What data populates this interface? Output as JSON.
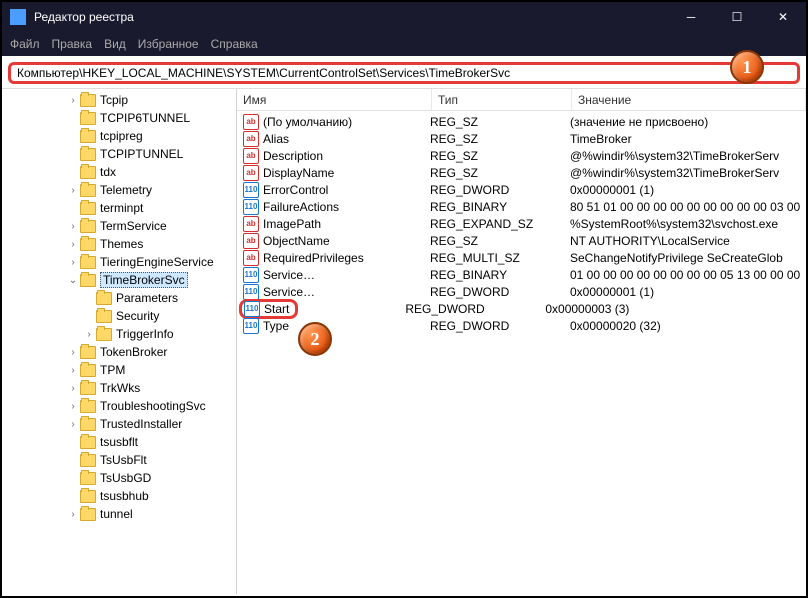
{
  "window": {
    "title": "Редактор реестра"
  },
  "menu": {
    "file": "Файл",
    "edit": "Правка",
    "view": "Вид",
    "fav": "Избранное",
    "help": "Справка"
  },
  "address": "Компьютер\\HKEY_LOCAL_MACHINE\\SYSTEM\\CurrentControlSet\\Services\\TimeBrokerSvc",
  "badges": {
    "b1": "1",
    "b2": "2"
  },
  "tree": [
    {
      "d": 4,
      "e": ">",
      "l": "Tcpip"
    },
    {
      "d": 4,
      "e": "",
      "l": "TCPIP6TUNNEL"
    },
    {
      "d": 4,
      "e": "",
      "l": "tcpipreg"
    },
    {
      "d": 4,
      "e": "",
      "l": "TCPIPTUNNEL"
    },
    {
      "d": 4,
      "e": "",
      "l": "tdx"
    },
    {
      "d": 4,
      "e": ">",
      "l": "Telemetry"
    },
    {
      "d": 4,
      "e": "",
      "l": "terminpt"
    },
    {
      "d": 4,
      "e": ">",
      "l": "TermService"
    },
    {
      "d": 4,
      "e": ">",
      "l": "Themes"
    },
    {
      "d": 4,
      "e": ">",
      "l": "TieringEngineService"
    },
    {
      "d": 4,
      "e": "v",
      "l": "TimeBrokerSvc",
      "sel": true
    },
    {
      "d": 5,
      "e": "",
      "l": "Parameters"
    },
    {
      "d": 5,
      "e": "",
      "l": "Security"
    },
    {
      "d": 5,
      "e": ">",
      "l": "TriggerInfo"
    },
    {
      "d": 4,
      "e": ">",
      "l": "TokenBroker"
    },
    {
      "d": 4,
      "e": ">",
      "l": "TPM"
    },
    {
      "d": 4,
      "e": ">",
      "l": "TrkWks"
    },
    {
      "d": 4,
      "e": ">",
      "l": "TroubleshootingSvc"
    },
    {
      "d": 4,
      "e": ">",
      "l": "TrustedInstaller"
    },
    {
      "d": 4,
      "e": "",
      "l": "tsusbflt"
    },
    {
      "d": 4,
      "e": "",
      "l": "TsUsbFlt"
    },
    {
      "d": 4,
      "e": "",
      "l": "TsUsbGD"
    },
    {
      "d": 4,
      "e": "",
      "l": "tsusbhub"
    },
    {
      "d": 4,
      "e": ">",
      "l": "tunnel"
    }
  ],
  "columns": {
    "name": "Имя",
    "type": "Тип",
    "value": "Значение"
  },
  "values": [
    {
      "ic": "str",
      "name": "(По умолчанию)",
      "type": "REG_SZ",
      "val": "(значение не присвоено)"
    },
    {
      "ic": "str",
      "name": "Alias",
      "type": "REG_SZ",
      "val": "TimeBroker"
    },
    {
      "ic": "str",
      "name": "Description",
      "type": "REG_SZ",
      "val": "@%windir%\\system32\\TimeBrokerServ"
    },
    {
      "ic": "str",
      "name": "DisplayName",
      "type": "REG_SZ",
      "val": "@%windir%\\system32\\TimeBrokerServ"
    },
    {
      "ic": "bin",
      "name": "ErrorControl",
      "type": "REG_DWORD",
      "val": "0x00000001 (1)"
    },
    {
      "ic": "bin",
      "name": "FailureActions",
      "type": "REG_BINARY",
      "val": "80 51 01 00 00 00 00 00 00 00 00 00 03 00"
    },
    {
      "ic": "str",
      "name": "ImagePath",
      "type": "REG_EXPAND_SZ",
      "val": "%SystemRoot%\\system32\\svchost.exe"
    },
    {
      "ic": "str",
      "name": "ObjectName",
      "type": "REG_SZ",
      "val": "NT AUTHORITY\\LocalService"
    },
    {
      "ic": "str",
      "name": "RequiredPrivileges",
      "type": "REG_MULTI_SZ",
      "val": "SeChangeNotifyPrivilege SeCreateGlob"
    },
    {
      "ic": "bin",
      "name": "Service…",
      "type": "REG_BINARY",
      "val": "01 00 00 00 00 00 00 00 00 05 13 00 00 00"
    },
    {
      "ic": "bin",
      "name": "Service…",
      "type": "REG_DWORD",
      "val": "0x00000001 (1)"
    },
    {
      "ic": "bin",
      "name": "Start",
      "type": "REG_DWORD",
      "val": "0x00000003 (3)",
      "hl": true
    },
    {
      "ic": "bin",
      "name": "Type",
      "type": "REG_DWORD",
      "val": "0x00000020 (32)"
    }
  ]
}
